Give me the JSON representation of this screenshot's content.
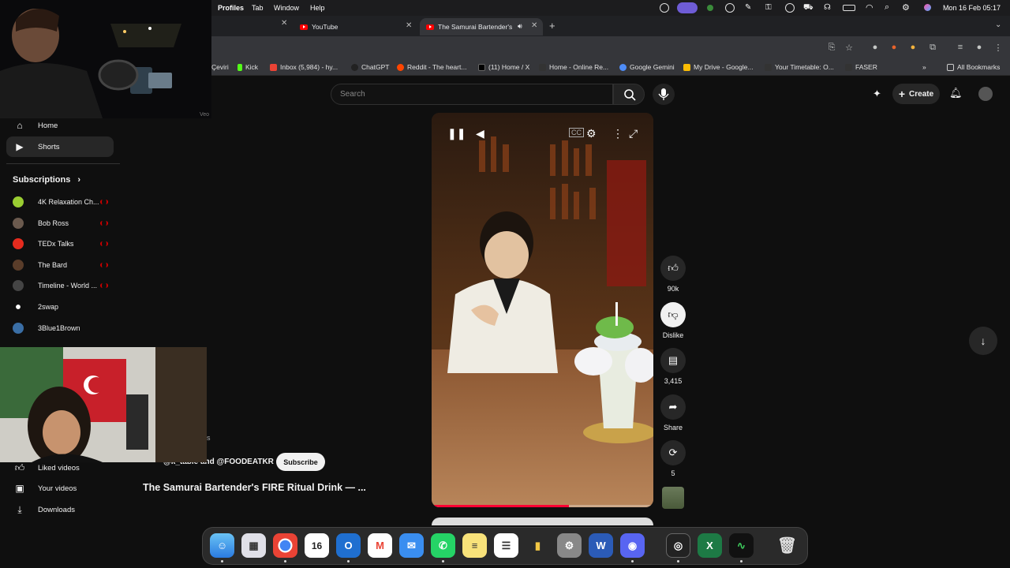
{
  "menubar": {
    "profiles": "Profiles",
    "tab": "Tab",
    "window": "Window",
    "help": "Help",
    "clock": "Mon 16 Feb  05:17"
  },
  "tabs": [
    {
      "label": "YouTube"
    },
    {
      "label": "The Samurai Bartender's"
    }
  ],
  "bookmarks": [
    {
      "label": "Çeviri"
    },
    {
      "label": "Kick"
    },
    {
      "label": "Inbox (5,984) - hy..."
    },
    {
      "label": "ChatGPT"
    },
    {
      "label": "Reddit - The heart..."
    },
    {
      "label": "(11) Home / X"
    },
    {
      "label": "Home - Online Re..."
    },
    {
      "label": "Google Gemini"
    },
    {
      "label": "My Drive - Google..."
    },
    {
      "label": "Your Timetable: O..."
    },
    {
      "label": "FASER"
    },
    {
      "label": "All Bookmarks"
    }
  ],
  "youtube": {
    "search_placeholder": "Search",
    "create_label": "Create",
    "sidebar": {
      "home": "Home",
      "shorts": "Shorts",
      "subscriptions": "Subscriptions",
      "liked": "Liked videos",
      "your_videos": "Your videos",
      "downloads": "Downloads",
      "hidden_fragment": "s"
    },
    "subscriptions": [
      {
        "name": "4K Relaxation Ch...",
        "color": "#9acd32"
      },
      {
        "name": "Bob Ross",
        "color": "#6b5a4e"
      },
      {
        "name": "TEDx Talks",
        "color": "#e62b1e"
      },
      {
        "name": "The Bard",
        "color": "#5a3d2a"
      },
      {
        "name": "Timeline - World ...",
        "color": "#444444"
      },
      {
        "name": "2swap",
        "color": "#000000"
      },
      {
        "name": "3Blue1Brown",
        "color": "#3a6ea5"
      }
    ],
    "short": {
      "channel": "@k_table and @FOODEATKR",
      "subscribe": "Subscribe",
      "title": "The Samurai Bartender's FIRE Ritual Drink — ...",
      "likes": "90k",
      "dislike": "Dislike",
      "comments": "3,415",
      "share": "Share",
      "remix": "5",
      "progress": 0.62
    },
    "webcam_label": "Veo"
  }
}
